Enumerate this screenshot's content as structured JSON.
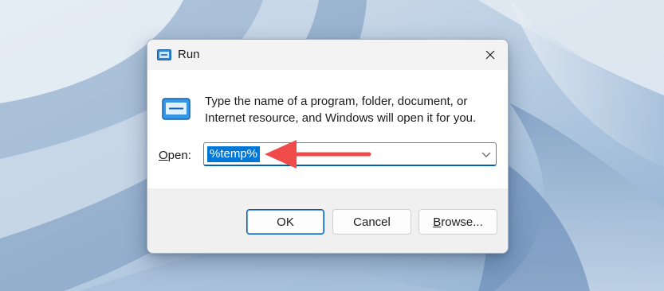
{
  "dialog": {
    "title": "Run",
    "icon": "run-icon",
    "close_icon": "close-icon",
    "description": "Type the name of a program, folder, document, or Internet resource, and Windows will open it for you.",
    "open_label_underlined": "O",
    "open_label_rest": "pen:",
    "open_value": "%temp%",
    "dropdown_icon": "chevron-down-icon"
  },
  "buttons": {
    "ok": "OK",
    "cancel": "Cancel",
    "browse_underlined": "B",
    "browse_rest": "rowse..."
  },
  "annotation": {
    "arrow_color": "#f04b4b",
    "arrow_icon": "arrow-left-icon"
  },
  "colors": {
    "accent": "#0078d7",
    "selection": "#0078d7"
  }
}
